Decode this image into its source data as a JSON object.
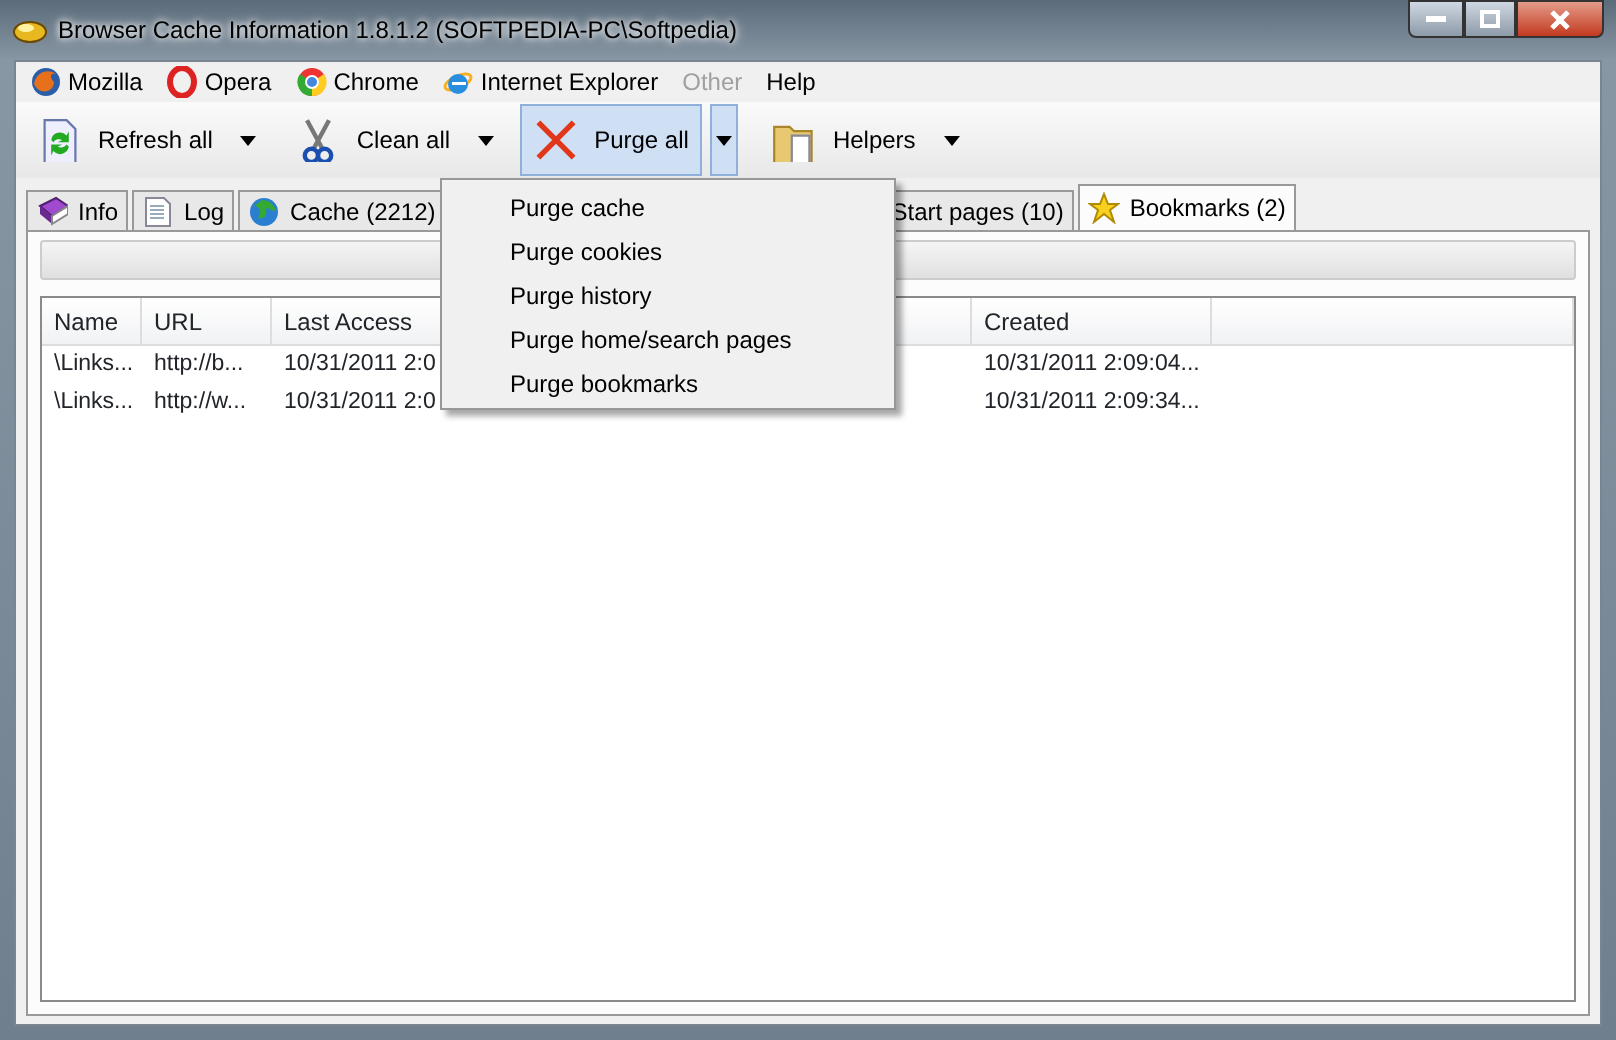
{
  "window": {
    "title": "Browser Cache Information 1.8.1.2 (SOFTPEDIA-PC\\Softpedia)"
  },
  "menu": [
    {
      "label": "Mozilla",
      "kind": "mozilla",
      "disabled": false
    },
    {
      "label": "Opera",
      "kind": "opera",
      "disabled": false
    },
    {
      "label": "Chrome",
      "kind": "chrome",
      "disabled": false
    },
    {
      "label": "Internet Explorer",
      "kind": "ie",
      "disabled": false
    },
    {
      "label": "Other",
      "kind": "none",
      "disabled": true
    },
    {
      "label": "Help",
      "kind": "none",
      "disabled": false
    }
  ],
  "toolbar": [
    {
      "label": "Refresh all",
      "kind": "refresh",
      "pressed": false
    },
    {
      "label": "Clean all",
      "kind": "scissors",
      "pressed": false
    },
    {
      "label": "Purge all",
      "kind": "purge",
      "pressed": true
    },
    {
      "label": "Helpers",
      "kind": "folder",
      "pressed": false
    }
  ],
  "tabs": [
    {
      "label": "Info",
      "kind": "book",
      "selected": false
    },
    {
      "label": "Log",
      "kind": "page",
      "selected": false
    },
    {
      "label": "Cache (2212)",
      "kind": "globe",
      "selected": false
    },
    {
      "label": "Start pages (10)",
      "kind": "none",
      "selected": false
    },
    {
      "label": "Bookmarks (2)",
      "kind": "star",
      "selected": true
    }
  ],
  "dropdown": {
    "items": [
      "Purge cache",
      "Purge cookies",
      "Purge history",
      "Purge home/search pages",
      "Purge bookmarks"
    ]
  },
  "list": {
    "columns": [
      "Name",
      "URL",
      "Last Access",
      "Created"
    ],
    "rows": [
      [
        "\\Links...",
        "http://b...",
        "10/31/2011 2:0",
        "10/31/2011 2:09:04..."
      ],
      [
        "\\Links...",
        "http://w...",
        "10/31/2011 2:0",
        "10/31/2011 2:09:34..."
      ]
    ]
  }
}
